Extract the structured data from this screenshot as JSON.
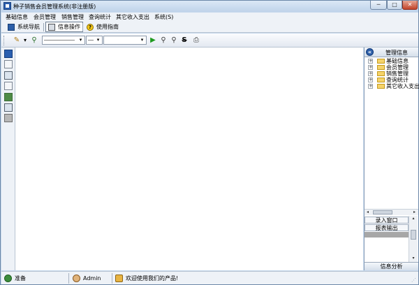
{
  "window": {
    "title": "种子销售会员管理系统(非注册版)",
    "min_glyph": "─",
    "max_glyph": "□",
    "close_glyph": "✕"
  },
  "menubar": {
    "items": [
      "基础信息",
      "会员管理",
      "销售管理",
      "查询统计",
      "其它收入支出",
      "系统(S)"
    ]
  },
  "tabbar": {
    "tabs": [
      {
        "label": "系统导航",
        "icon": "navigation-icon"
      },
      {
        "label": "信息操作",
        "icon": "info-operation-icon"
      },
      {
        "label": "使用指南",
        "icon": "help-icon"
      }
    ],
    "active_index": 1,
    "help_glyph": "?"
  },
  "toolbar": {
    "pencil_glyph": "✎",
    "dropdown_glyph": "▾",
    "play_glyph": "▶",
    "find_glyph": "⚲",
    "find_next_glyph": "⚲",
    "strike_glyph": "S",
    "print_glyph": "⎙"
  },
  "right_panel": {
    "title": "管理信息",
    "back_glyph": "«",
    "tree": [
      {
        "label": "基础信息",
        "expander": "+"
      },
      {
        "label": "会员管理",
        "expander": "+"
      },
      {
        "label": "销售管理",
        "expander": "+"
      },
      {
        "label": "查询统计",
        "expander": "+"
      },
      {
        "label": "其它收入支出",
        "expander": "+"
      }
    ],
    "list": [
      "录入窗口",
      "报表输出"
    ],
    "footer": "信息分析",
    "scroll_left": "◂",
    "scroll_right": "▸",
    "scroll_up": "▴",
    "scroll_down": "▾"
  },
  "statusbar": {
    "ready": "准备",
    "user": "Admin",
    "message": "欢迎使用我们的产品!"
  },
  "colors": {
    "frame": "#c6d8ec",
    "accent": "#2d5fa8",
    "folder": "#f5d36a"
  }
}
